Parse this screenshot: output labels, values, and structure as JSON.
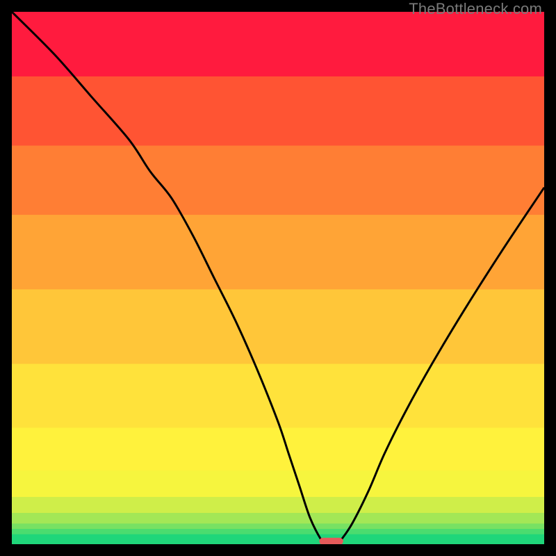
{
  "watermark": "TheBottleneck.com",
  "chart_data": {
    "type": "line",
    "title": "",
    "xlabel": "",
    "ylabel": "",
    "xlim": [
      0,
      100
    ],
    "ylim": [
      0,
      100
    ],
    "background_bands": [
      {
        "y0": 0,
        "y1": 2,
        "color": "#1fd67a"
      },
      {
        "y0": 2,
        "y1": 3,
        "color": "#4bdc6f"
      },
      {
        "y0": 3,
        "y1": 4,
        "color": "#77e163"
      },
      {
        "y0": 4,
        "y1": 6,
        "color": "#a3e756"
      },
      {
        "y0": 6,
        "y1": 9,
        "color": "#cfee49"
      },
      {
        "y0": 9,
        "y1": 14,
        "color": "#f6f53e"
      },
      {
        "y0": 14,
        "y1": 22,
        "color": "#fff23c"
      },
      {
        "y0": 22,
        "y1": 34,
        "color": "#ffe23b"
      },
      {
        "y0": 34,
        "y1": 48,
        "color": "#ffc639"
      },
      {
        "y0": 48,
        "y1": 62,
        "color": "#ffa436"
      },
      {
        "y0": 62,
        "y1": 75,
        "color": "#ff7e34"
      },
      {
        "y0": 75,
        "y1": 88,
        "color": "#ff5433"
      },
      {
        "y0": 88,
        "y1": 100,
        "color": "#ff1b3e"
      }
    ],
    "curve": {
      "x": [
        0,
        8,
        15,
        22,
        26,
        30,
        34,
        38,
        42,
        46,
        50,
        52,
        54,
        56,
        58,
        59,
        61,
        62,
        64,
        67,
        70,
        74,
        79,
        85,
        92,
        100
      ],
      "y": [
        100,
        92,
        84,
        76,
        70,
        65,
        58,
        50,
        42,
        33,
        23,
        17,
        11,
        5,
        1,
        0,
        0,
        1,
        4,
        10,
        17,
        25,
        34,
        44,
        55,
        67
      ]
    },
    "marker": {
      "x": 60,
      "y": 0,
      "w": 4.5,
      "h": 1.2,
      "color": "#e55a5a"
    }
  }
}
